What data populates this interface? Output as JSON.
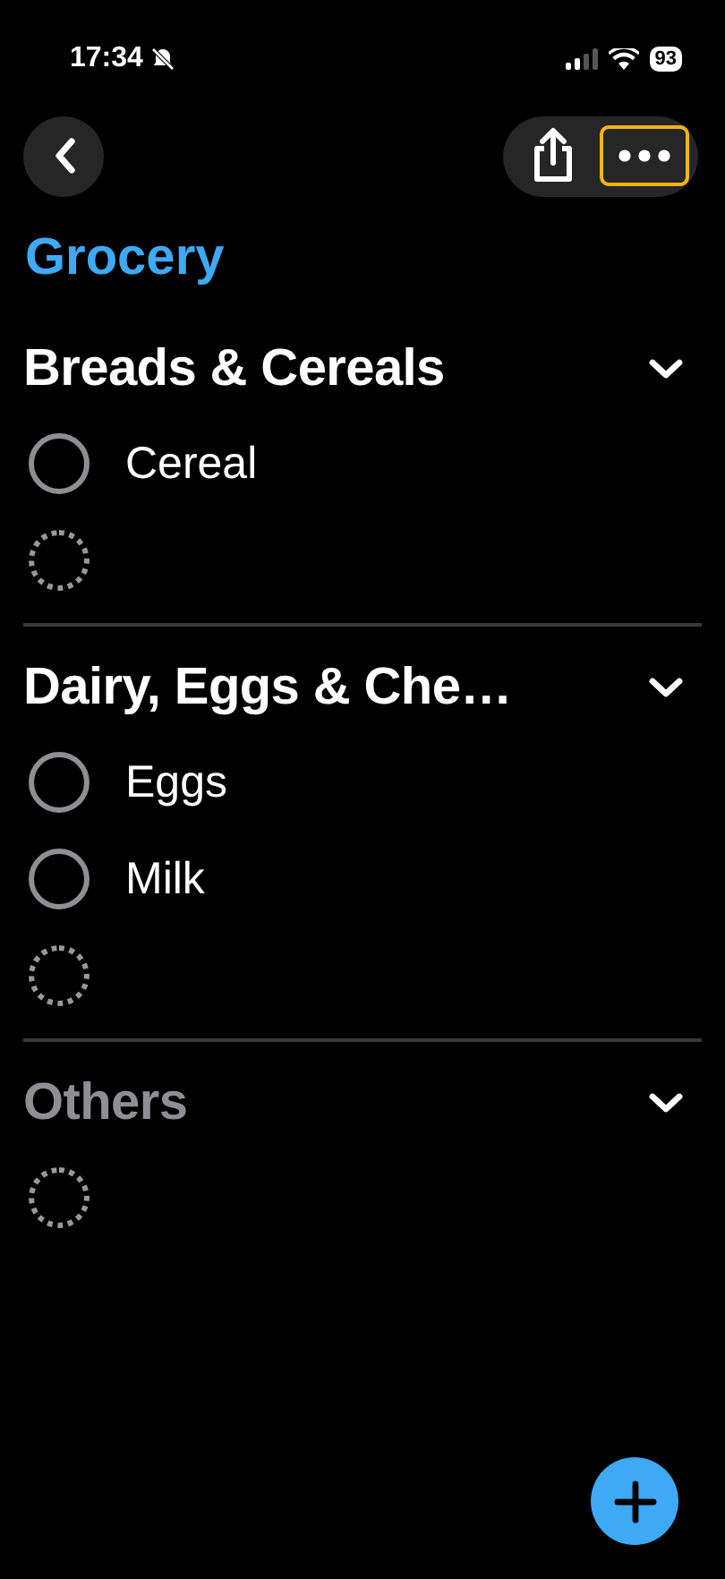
{
  "status_bar": {
    "time": "17:34",
    "battery": "93"
  },
  "nav": {
    "more_focused": true
  },
  "title": "Grocery",
  "sections": [
    {
      "name": "Breads & Cereals",
      "muted": false,
      "items": [
        {
          "kind": "item",
          "label": "Cereal"
        },
        {
          "kind": "new"
        }
      ]
    },
    {
      "name": "Dairy, Eggs & Che…",
      "muted": false,
      "items": [
        {
          "kind": "item",
          "label": "Eggs"
        },
        {
          "kind": "item",
          "label": "Milk"
        },
        {
          "kind": "new"
        }
      ]
    },
    {
      "name": "Others",
      "muted": true,
      "items": [
        {
          "kind": "new"
        }
      ]
    }
  ]
}
